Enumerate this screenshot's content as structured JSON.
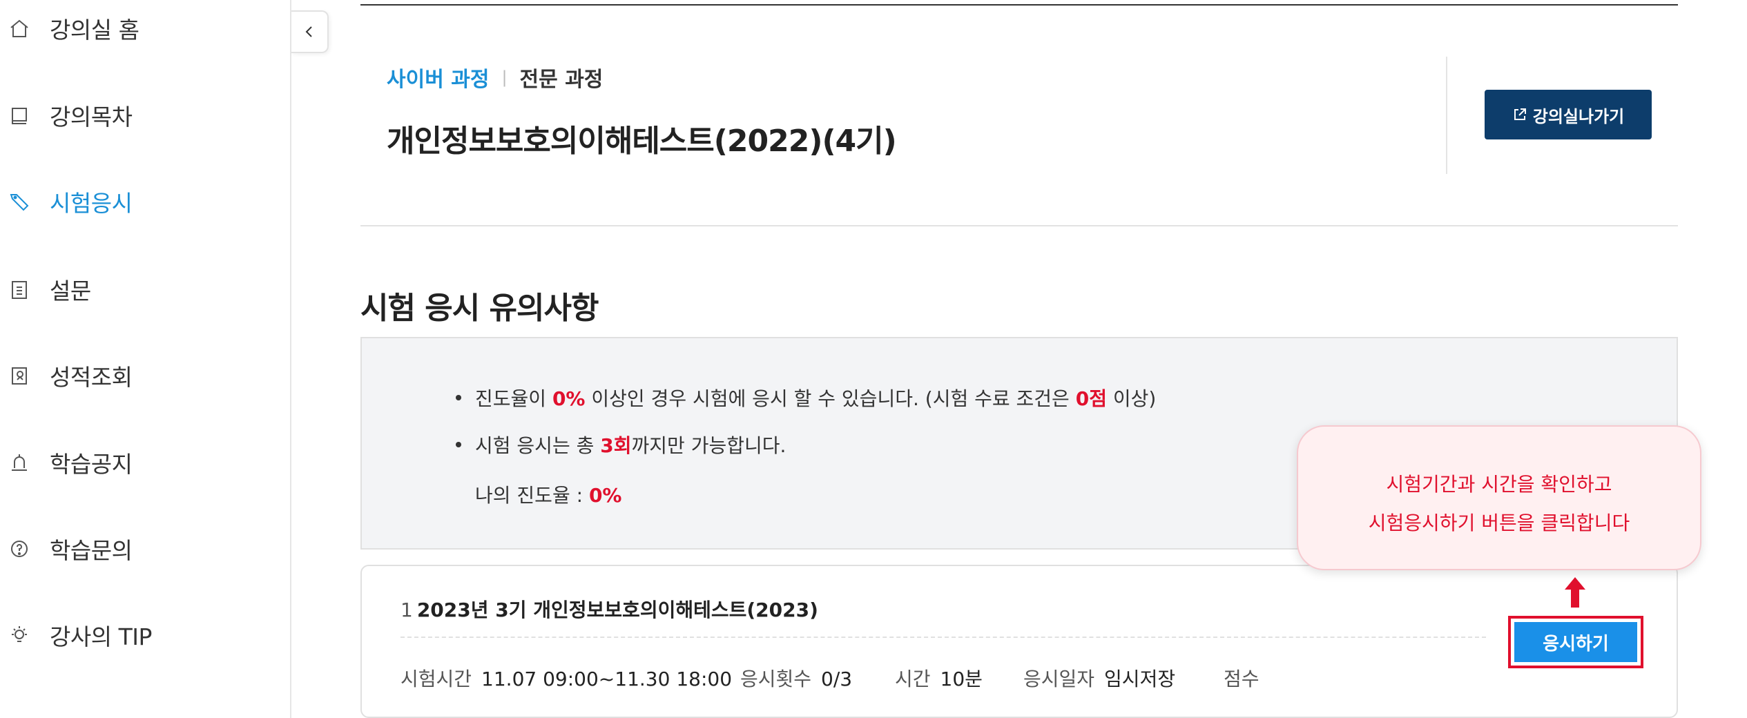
{
  "sidebar": {
    "items": [
      {
        "label": "강의실 홈",
        "icon": "home-icon"
      },
      {
        "label": "강의목차",
        "icon": "book-icon"
      },
      {
        "label": "시험응시",
        "icon": "tag-icon",
        "active": true
      },
      {
        "label": "설문",
        "icon": "clipboard-icon"
      },
      {
        "label": "성적조회",
        "icon": "report-icon"
      },
      {
        "label": "학습공지",
        "icon": "bell-icon"
      },
      {
        "label": "학습문의",
        "icon": "question-icon"
      },
      {
        "label": "강사의 TIP",
        "icon": "lightbulb-icon"
      }
    ],
    "active_color": "#1a8fd6"
  },
  "course": {
    "type_primary": "사이버 과정",
    "type_secondary": "전문 과정",
    "title": "개인정보보호의이해테스트(2022)(4기)",
    "go_class_label": "강의실나가기"
  },
  "notice": {
    "section_title": "시험 응시 유의사항",
    "bullet1_pre": "진도율이 ",
    "bullet1_val": "0%",
    "bullet1_mid": " 이상인 경우 시험에 응시 할 수 있습니다. (시험 수료 조건은 ",
    "bullet1_score": "0점",
    "bullet1_post": " 이상)",
    "bullet2_pre": "시험 응시는 총 ",
    "bullet2_val": "3회",
    "bullet2_post": "까지만 가능합니다.",
    "progress_label": "나의 진도율 : ",
    "progress_value": "0%"
  },
  "exam": {
    "number": "1",
    "title": "2023년 3기 개인정보보호의이해테스트(2023)",
    "period_label": "시험시간",
    "period_value": "11.07 09:00~11.30 18:00",
    "attempts_label": "응시횟수",
    "attempts_value": "0/3",
    "time_label": "시간",
    "time_value": "10분",
    "date_label": "응시일자",
    "date_value": "임시저장",
    "score_label": "점수",
    "apply_label": "응시하기"
  },
  "tooltip": {
    "line1": "시험기간과 시간을 확인하고",
    "line2": "시험응시하기 버튼을 클릭합니다"
  },
  "colors": {
    "accent_blue": "#1a8fd6",
    "navy": "#0d3d6b",
    "highlight_red": "#e0102d",
    "apply_blue": "#1a90e8"
  }
}
